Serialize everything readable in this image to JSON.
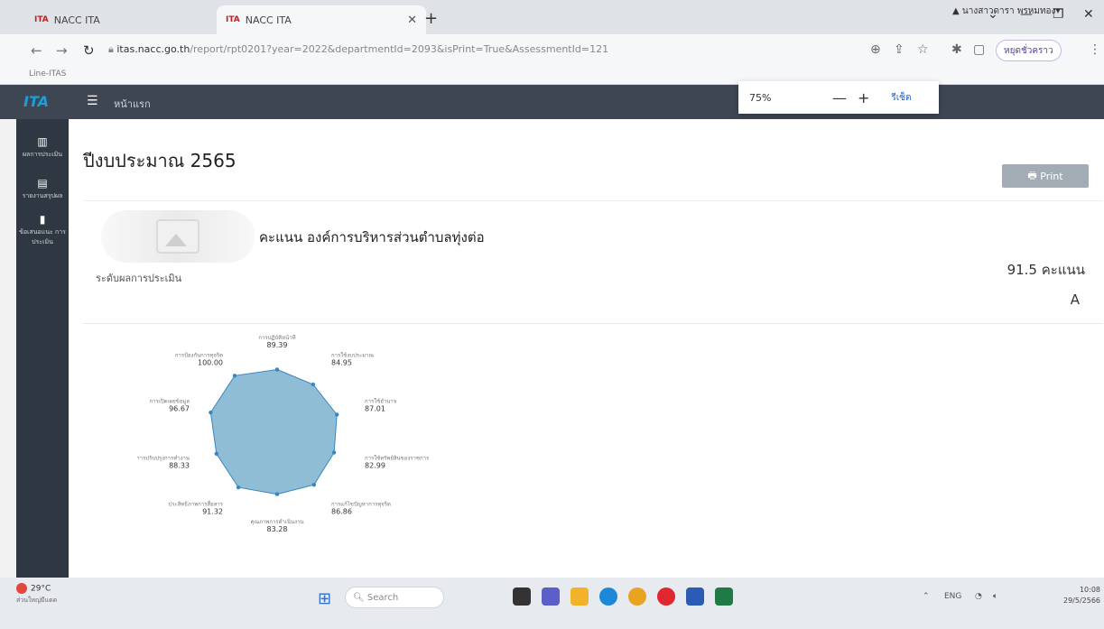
{
  "browser": {
    "tabs": [
      {
        "favicon": "ITA",
        "label": "NACC ITA"
      },
      {
        "favicon": "ITA",
        "label": "NACC ITA"
      }
    ],
    "url_host": "itas.nacc.go.th",
    "url_path": "/report/rpt0201?year=2022&departmentId=2093&isPrint=True&AssessmentId=121",
    "bookmark": "Line-ITAS",
    "profile_label": "หยุดชั่วคราว",
    "zoom": {
      "level": "75%",
      "reset_label": "รีเซ็ต"
    }
  },
  "app": {
    "brand": "ITA",
    "home_label": "หน้าแรก",
    "user": "นางสาวดารา พรหมทอง",
    "sidebar": [
      {
        "icon": "chart-icon",
        "label": "ผลการประเมิน"
      },
      {
        "icon": "document-icon",
        "label": "รายงานสรุปผล"
      },
      {
        "icon": "clipboard-icon",
        "label": "ข้อเสนอแนะ การประเมิน"
      }
    ]
  },
  "page": {
    "title": "ปีงบประมาณ 2565",
    "print_label": "Print",
    "score_title": "คะแนน องค์การบริหารส่วนตำบลทุ่งต่อ",
    "result_label": "ระดับผลการประเมิน",
    "score_value": "91.5 คะแนน",
    "grade": "A"
  },
  "chart_data": {
    "type": "radar",
    "categories": [
      "การปฏิบัติหน้าที่",
      "การใช้งบประมาณ",
      "การใช้อำนาจ",
      "การใช้ทรัพย์สินของราชการ",
      "การแก้ไขปัญหาการทุจริต",
      "คุณภาพการดำเนินงาน",
      "ประสิทธิภาพการสื่อสาร",
      "การปรับปรุงการทำงาน",
      "การเปิดเผยข้อมูล",
      "การป้องกันการทุจริต"
    ],
    "value_labels": [
      "89.39",
      "84.95",
      "87.01",
      "82.99",
      "86.86",
      "83.28",
      "91.32",
      "88.33",
      "96.67",
      "100.00"
    ],
    "values": [
      89.39,
      84.95,
      87.01,
      82.99,
      86.86,
      83.28,
      91.32,
      88.33,
      96.67,
      100.0
    ],
    "rlim": [
      0,
      100
    ],
    "color": "#8fbdd6",
    "point_color": "#3a86c0"
  },
  "taskbar": {
    "temperature": "29°C",
    "weather_desc": "ส่วนใหญ่มีแดด",
    "search_placeholder": "Search",
    "lang": "ENG",
    "time": "10:08",
    "date": "29/5/2566"
  }
}
